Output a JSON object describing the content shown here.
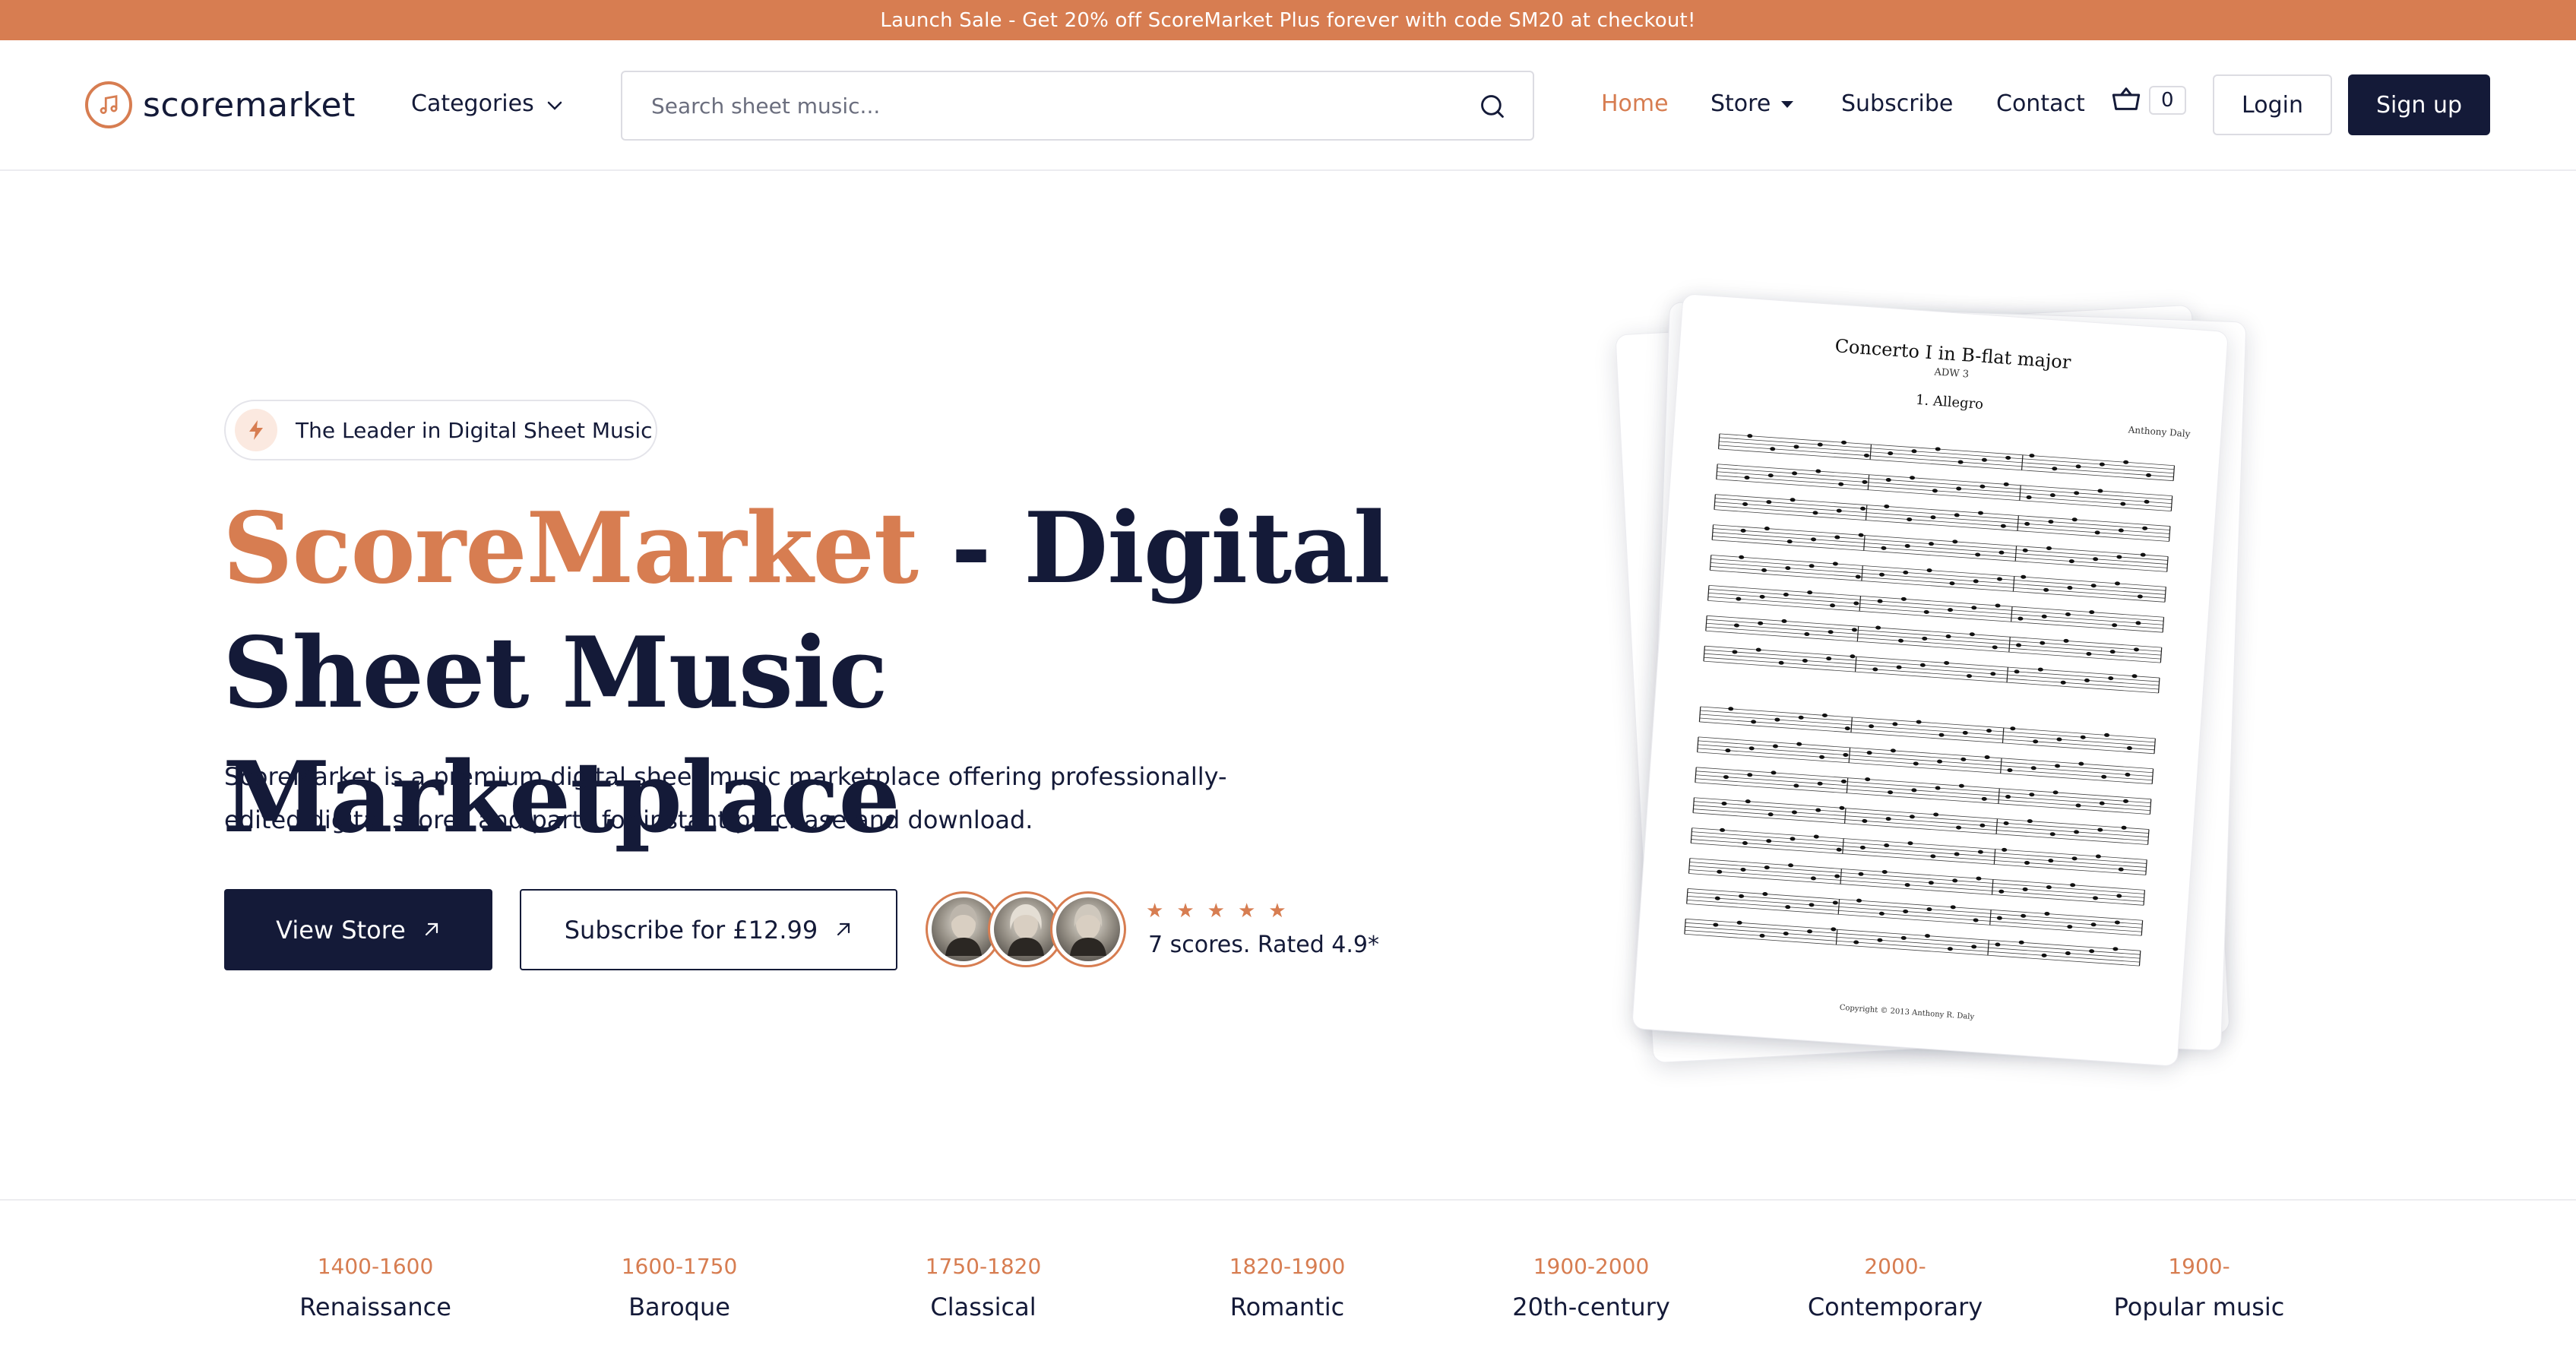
{
  "announcement": "Launch Sale - Get 20% off ScoreMarket Plus forever with code SM20 at checkout!",
  "header": {
    "logo_text": "scoremarket",
    "categories_label": "Categories",
    "search_placeholder": "Search sheet music...",
    "nav": {
      "home": "Home",
      "store": "Store",
      "subscribe": "Subscribe",
      "contact": "Contact"
    },
    "cart_count": "0",
    "login": "Login",
    "signup": "Sign up"
  },
  "hero": {
    "badge": "The Leader in Digital Sheet Music",
    "title_accent": "ScoreMarket",
    "title_rest": " - Digital Sheet Music Marketplace",
    "description": "ScoreMarket is a premium digital sheet music marketplace offering professionally-edited digital scores and parts for instant purchase and download.",
    "view_store": "View Store",
    "subscribe": "Subscribe for £12.99",
    "rating_stars": 5,
    "rating_text": "7 scores. Rated 4.9*"
  },
  "score": {
    "title": "Concerto I in B-flat major",
    "catalog": "ADW 3",
    "movement": "1. Allegro",
    "composer": "Anthony Daly",
    "copyright": "Copyright © 2013 Anthony R. Daly"
  },
  "eras": [
    {
      "years": "1400-1600",
      "name": "Renaissance"
    },
    {
      "years": "1600-1750",
      "name": "Baroque"
    },
    {
      "years": "1750-1820",
      "name": "Classical"
    },
    {
      "years": "1820-1900",
      "name": "Romantic"
    },
    {
      "years": "1900-2000",
      "name": "20th-century"
    },
    {
      "years": "2000-",
      "name": "Contemporary"
    },
    {
      "years": "1900-",
      "name": "Popular music"
    }
  ],
  "colors": {
    "accent": "#d77d51",
    "navy": "#141a38"
  }
}
